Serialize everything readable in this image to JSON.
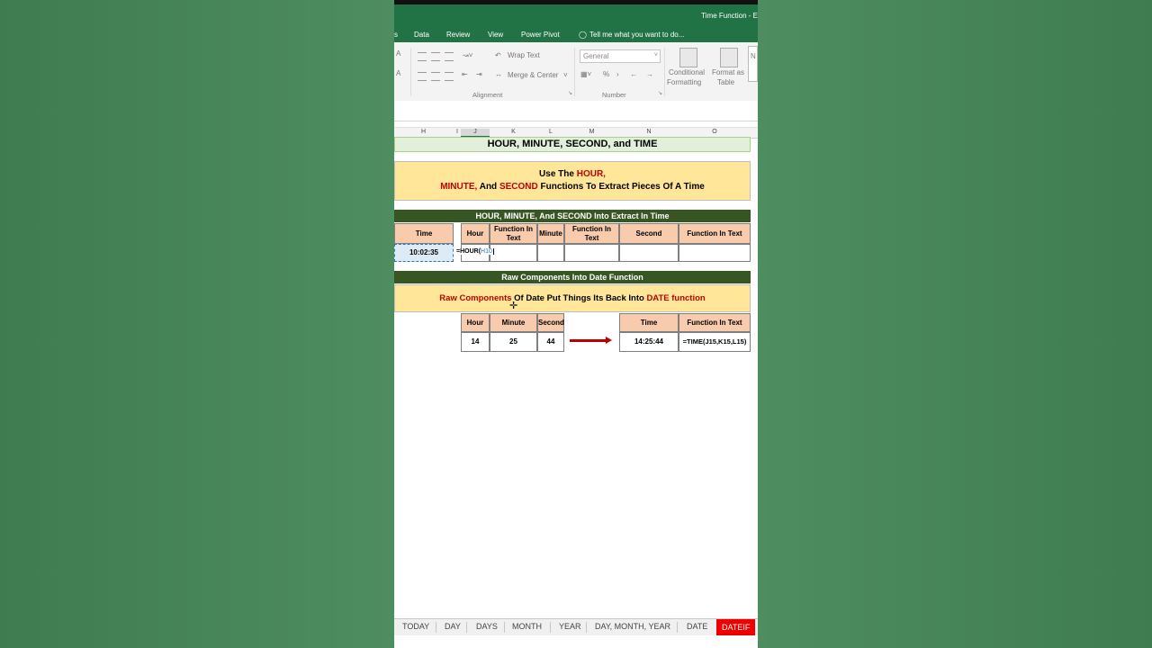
{
  "window": {
    "title": "Time Function - E"
  },
  "ribbon_tabs": [
    "s",
    "Data",
    "Review",
    "View",
    "Power Pivot",
    "Tell me what you want to do..."
  ],
  "ribbon": {
    "wrap_text": "Wrap Text",
    "merge_center": "Merge & Center",
    "alignment_group": "Alignment",
    "number_format": "General",
    "number_group": "Number",
    "percent": "%",
    "conditional_formatting_1": "Conditional",
    "conditional_formatting_2": "Formatting",
    "format_as_table_1": "Format as",
    "format_as_table_2": "Table",
    "cut_off_letter": "N"
  },
  "columns": [
    "H",
    "I",
    "J",
    "K",
    "L",
    "M",
    "N",
    "O"
  ],
  "sheet": {
    "main_title": "HOUR, MINUTE, SECOND, and TIME",
    "banner1_line1_prefix": "Use The ",
    "banner1_line1_red": "HOUR,",
    "banner1_line2_red": "MINUTE,",
    "banner1_line2_mid": " And ",
    "banner1_line2_red2": "SECOND",
    "banner1_line2_suffix": " Functions To Extract Pieces Of A Time",
    "section1_title": "HOUR, MINUTE,  And SECOND Into Extract In Time",
    "table1_headers": {
      "time": "Time",
      "hour": "Hour",
      "fn1_line1": "Function In",
      "fn1_line2": "Text",
      "minute": "Minute",
      "fn2_line1": "Function In",
      "fn2_line2": "Text",
      "second": "Second",
      "fn3": "Function In Text"
    },
    "time_value": "10:02:35",
    "formula_typing_prefix": "=HOUR(",
    "formula_typing_ref": "H10",
    "section2_title": "Raw Components Into Date Function",
    "banner2_red": "Raw Components",
    "banner2_mid": " Of Date Put Things Its Back Into ",
    "banner2_red2": "DATE function",
    "table2_headers": {
      "hour": "Hour",
      "minute": "Minute",
      "second": "Second",
      "time": "Time",
      "fn": "Function In Text"
    },
    "table2_values": {
      "hour": "14",
      "minute": "25",
      "second": "44",
      "time": "14:25:44",
      "fn": "=TIME(J15,K15,L15)"
    }
  },
  "sheet_tabs": [
    "TODAY",
    "DAY",
    "DAYS",
    "MONTH",
    "YEAR",
    "DAY, MONTH, YEAR",
    "DATE",
    "DATEIF"
  ],
  "colors": {
    "excel_green": "#217346",
    "header_peach": "#f8cbad",
    "banner_yellow": "#ffe699",
    "section_green": "#375623",
    "accent_red": "#c00000",
    "active_tab_red": "#ee0000",
    "background_green": "#4b8a5c"
  }
}
